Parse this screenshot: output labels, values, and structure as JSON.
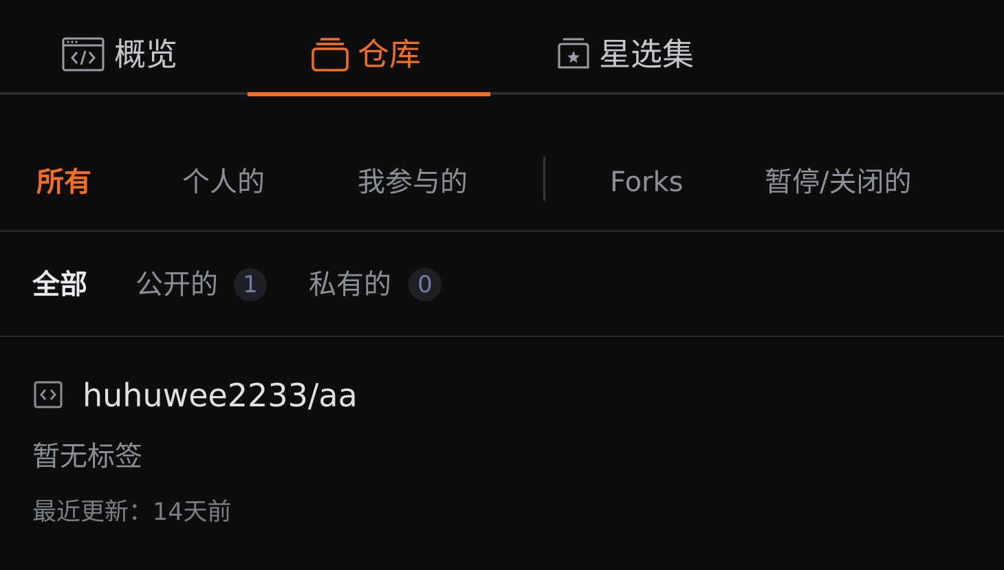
{
  "top_tabs": [
    {
      "label": "概览",
      "icon": "code-window-icon",
      "active": false
    },
    {
      "label": "仓库",
      "icon": "repository-icon",
      "active": true
    },
    {
      "label": "星选集",
      "icon": "star-collection-icon",
      "active": false
    }
  ],
  "filters": [
    {
      "label": "所有",
      "active": true
    },
    {
      "label": "个人的",
      "active": false
    },
    {
      "label": "我参与的",
      "active": false
    },
    {
      "label": "Forks",
      "active": false
    },
    {
      "label": "暂停/关闭的",
      "active": false
    }
  ],
  "visibility": {
    "all_label": "全部",
    "public_label": "公开的",
    "public_count": "1",
    "private_label": "私有的",
    "private_count": "0"
  },
  "repo": {
    "icon": "code-repo-icon",
    "name": "huhuwee2233/aa",
    "tags": "暂无标签",
    "updated": "最近更新：14天前"
  },
  "colors": {
    "accent": "#f26f21",
    "background": "#0d0d0e",
    "badge_text": "#6f7fa8"
  }
}
